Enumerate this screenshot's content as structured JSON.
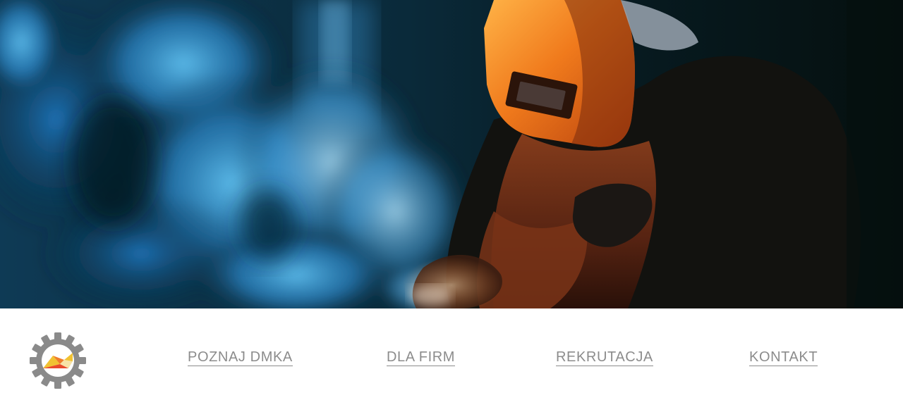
{
  "hero": {
    "image": "welder-with-orange-mask-and-blue-smoke-photo"
  },
  "logo": {
    "icon": "gear-logo-icon",
    "gear_color": "#8a8a8a",
    "accent_colors": [
      "#f1c232",
      "#ef7d2a",
      "#e94a2b",
      "#f7e2a6"
    ]
  },
  "nav": {
    "items": [
      {
        "label": "POZNAJ DMKA"
      },
      {
        "label": "DLA FIRM"
      },
      {
        "label": "REKRUTACJA"
      },
      {
        "label": "KONTAKT"
      }
    ],
    "text_color": "#8c8c8c"
  }
}
